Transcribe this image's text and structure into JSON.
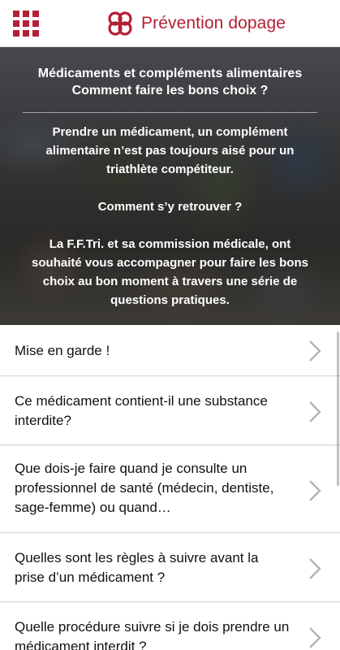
{
  "app": {
    "title": "Prévention dopage",
    "brand_color": "#b41f35",
    "menu_icon": "grid-menu-icon",
    "logo_icon": "interlinked-rings-logo-icon"
  },
  "hero": {
    "title": "Médicaments et compléments alimentaires Comment faire les bons choix ?",
    "paragraph1": "Prendre un médicament, un complément alimentaire n’est pas toujours aisé pour un triathlète compétiteur.",
    "paragraph2": "Comment s’y retrouver ?",
    "paragraph3": "La F.F.Tri. et sa commission médicale, ont souhaité vous accompagner pour faire les bons choix au bon moment à travers une série de questions pratiques."
  },
  "list": {
    "chevron_icon": "chevron-right-icon",
    "items": [
      {
        "label": "Mise en garde !"
      },
      {
        "label": "Ce médicament contient-il une substance interdite?"
      },
      {
        "label": "Que dois-je faire quand je consulte un professionnel de santé (médecin, dentiste, sage-femme) ou quand…"
      },
      {
        "label": "Quelles sont les règles à suivre avant la prise d’un médicament ?"
      },
      {
        "label": "Quelle procédure suivre si je dois prendre un médicament interdit ?"
      }
    ]
  }
}
